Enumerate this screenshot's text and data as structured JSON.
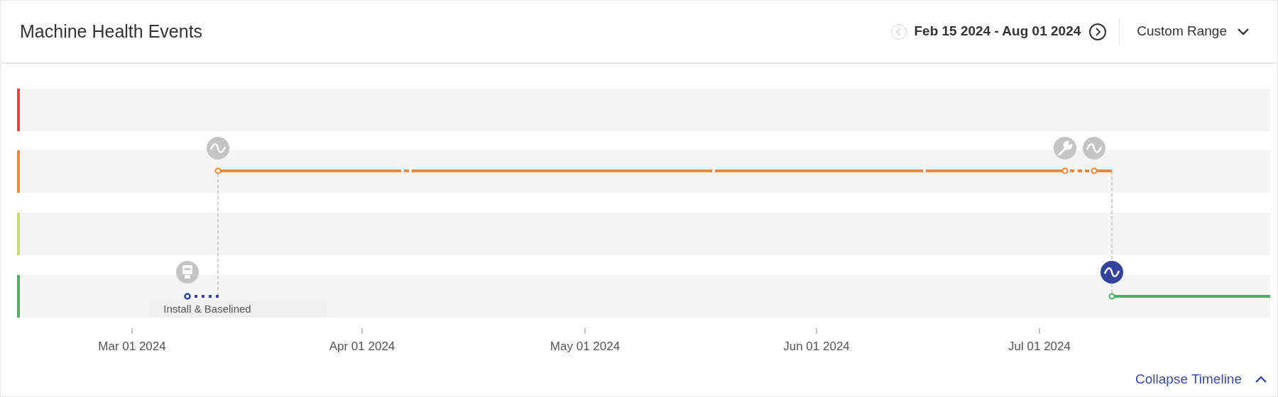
{
  "title": "Machine Health Events",
  "date_range": {
    "label": "Feb 15 2024 - Aug 01 2024",
    "previous_disabled": true,
    "next_disabled": false
  },
  "range_select": {
    "value": "Custom Range"
  },
  "lanes": [
    {
      "color": "#e8453c"
    },
    {
      "color": "#f0883a"
    },
    {
      "color": "#c5e06a"
    },
    {
      "color": "#4caf63"
    }
  ],
  "events": [
    {
      "kind": "wave",
      "selected": false
    },
    {
      "kind": "sensor",
      "selected": false
    },
    {
      "kind": "wrench",
      "selected": false
    },
    {
      "kind": "wave",
      "selected": false
    },
    {
      "kind": "wave",
      "selected": true
    }
  ],
  "install_label": "Install & Baselined",
  "axis_labels": [
    "Mar 01 2024",
    "Apr 01 2024",
    "May 01 2024",
    "Jun 01 2024",
    "Jul 01 2024"
  ],
  "collapse_link": "Collapse Timeline"
}
